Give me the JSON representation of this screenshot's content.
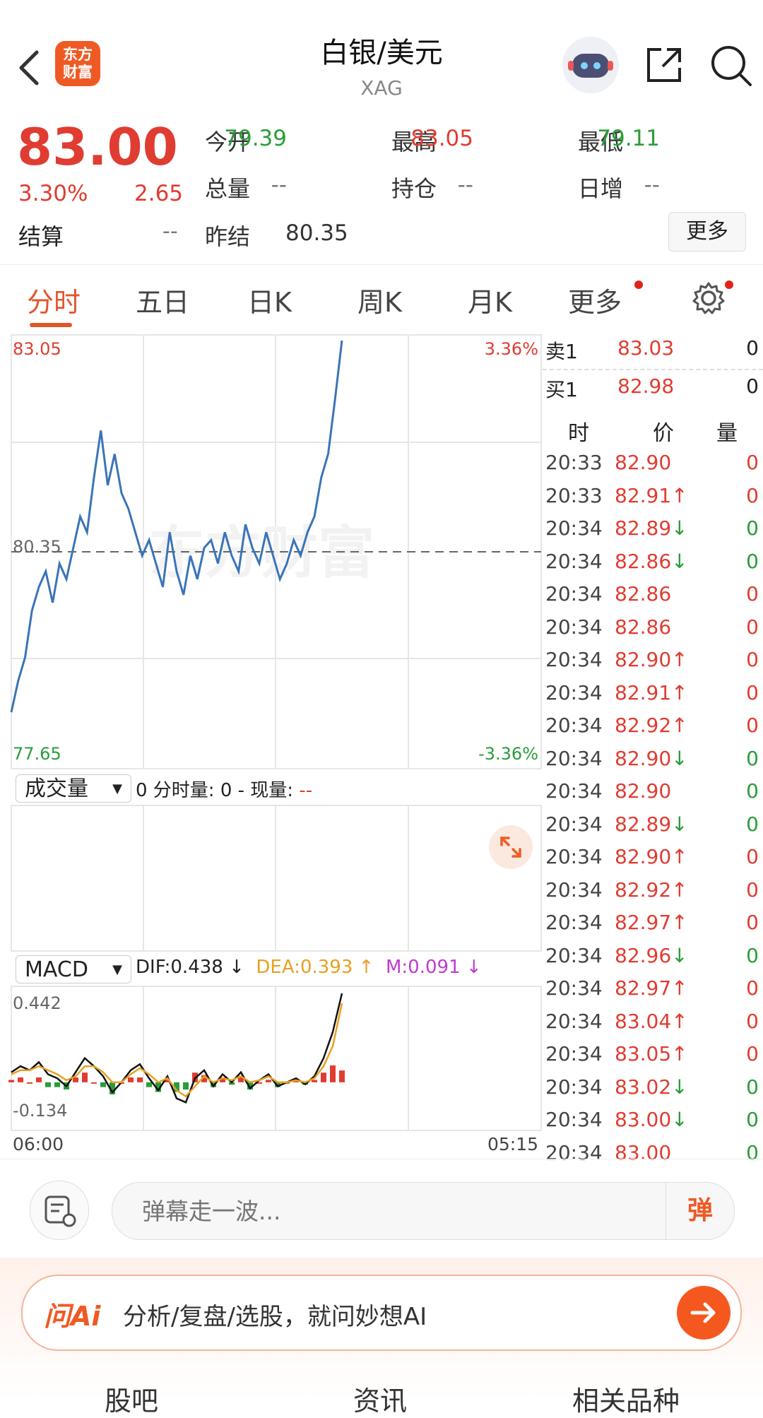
{
  "header": {
    "logo_line1": "东方",
    "logo_line2": "财富",
    "title": "白银/美元",
    "subtitle": "XAG"
  },
  "quote": {
    "price": "83.00",
    "change_pct": "3.30%",
    "change_abs": "2.65",
    "settle_label": "结算",
    "settle_value": "--",
    "rows": [
      [
        {
          "label": "今开",
          "value": "79.39",
          "color": "green"
        },
        {
          "label": "最高",
          "value": "83.05",
          "color": "red"
        },
        {
          "label": "最低",
          "value": "79.11",
          "color": "green"
        }
      ],
      [
        {
          "label": "总量",
          "value": "--",
          "color": "gray"
        },
        {
          "label": "持仓",
          "value": "--",
          "color": "gray"
        },
        {
          "label": "日增",
          "value": "--",
          "color": "gray"
        }
      ],
      [
        {
          "label": "昨结",
          "value": "80.35",
          "color": "dark"
        }
      ]
    ],
    "more_button": "更多"
  },
  "tabs": [
    "分时",
    "五日",
    "日K",
    "周K",
    "月K",
    "更多"
  ],
  "chart_data": [
    {
      "type": "line",
      "title": "",
      "series": [
        {
          "values": [
            78.3,
            78.7,
            79.0,
            79.6,
            79.9,
            80.1,
            79.7,
            80.2,
            80.0,
            80.4,
            80.8,
            80.6,
            81.3,
            81.9,
            81.2,
            81.6,
            81.1,
            80.9,
            80.6,
            80.3,
            80.5,
            80.2,
            79.9,
            80.6,
            80.1,
            79.8,
            80.3,
            80.0,
            80.4,
            80.5,
            80.2,
            80.6,
            80.3,
            80.1,
            80.7,
            80.4,
            80.2,
            80.6,
            80.3,
            80.0,
            80.2,
            80.5,
            80.3,
            80.6,
            80.8,
            81.3,
            81.6,
            82.3,
            83.05
          ]
        }
      ],
      "ylim": [
        77.65,
        83.05
      ],
      "ref_line": 80.35,
      "y_ticks": [
        "83.05",
        "80.35",
        "77.65"
      ],
      "pct_ticks": [
        "3.36%",
        "-3.36%"
      ],
      "x_ticks": [
        "06:00",
        "05:15"
      ]
    },
    {
      "type": "line",
      "title": "",
      "series": [
        {
          "name": "DIF",
          "values": [
            0.05,
            0.08,
            0.06,
            0.1,
            0.04,
            0.02,
            -0.02,
            0.05,
            0.12,
            0.08,
            0.03,
            -0.05,
            0.0,
            0.06,
            0.09,
            0.02,
            -0.04,
            0.03,
            -0.08,
            -0.1,
            0.02,
            0.06,
            -0.02,
            0.04,
            0.0,
            0.05,
            -0.03,
            0.01,
            0.04,
            -0.02,
            0.0,
            0.02,
            -0.01,
            0.03,
            0.12,
            0.25,
            0.442
          ]
        },
        {
          "name": "DEA",
          "values": [
            0.04,
            0.06,
            0.06,
            0.08,
            0.06,
            0.04,
            0.01,
            0.03,
            0.08,
            0.08,
            0.05,
            0.0,
            0.0,
            0.04,
            0.07,
            0.04,
            0.0,
            0.02,
            -0.04,
            -0.07,
            -0.02,
            0.03,
            0.0,
            0.02,
            0.01,
            0.03,
            0.0,
            0.01,
            0.03,
            0.0,
            0.0,
            0.01,
            0.0,
            0.02,
            0.08,
            0.18,
            0.393
          ]
        }
      ],
      "ylim": [
        -0.134,
        0.442
      ],
      "y_ticks": [
        "0.442",
        "-0.134"
      ]
    }
  ],
  "volume": {
    "selector": "成交量",
    "info": "0 分时量: 0 - 现量: ",
    "info_tail": "--"
  },
  "macd": {
    "selector": "MACD",
    "dif": "DIF:0.438 ↓",
    "dea": "DEA:0.393 ↑",
    "m": "M:0.091 ↓"
  },
  "book": {
    "sell_label": "卖1",
    "sell_price": "83.03",
    "sell_vol": "0",
    "buy_label": "买1",
    "buy_price": "82.98",
    "buy_vol": "0",
    "head": [
      "时",
      "价",
      "量"
    ]
  },
  "ticks": [
    [
      "20:33",
      "82.90",
      "",
      "0"
    ],
    [
      "20:33",
      "82.91",
      "↑",
      "0"
    ],
    [
      "20:34",
      "82.89",
      "↓",
      "0"
    ],
    [
      "20:34",
      "82.86",
      "↓",
      "0"
    ],
    [
      "20:34",
      "82.86",
      "",
      "0"
    ],
    [
      "20:34",
      "82.86",
      "",
      "0"
    ],
    [
      "20:34",
      "82.90",
      "↑",
      "0"
    ],
    [
      "20:34",
      "82.91",
      "↑",
      "0"
    ],
    [
      "20:34",
      "82.92",
      "↑",
      "0"
    ],
    [
      "20:34",
      "82.90",
      "↓",
      "0"
    ],
    [
      "20:34",
      "82.90",
      "",
      "0"
    ],
    [
      "20:34",
      "82.89",
      "↓",
      "0"
    ],
    [
      "20:34",
      "82.90",
      "↑",
      "0"
    ],
    [
      "20:34",
      "82.92",
      "↑",
      "0"
    ],
    [
      "20:34",
      "82.97",
      "↑",
      "0"
    ],
    [
      "20:34",
      "82.96",
      "↓",
      "0"
    ],
    [
      "20:34",
      "82.97",
      "↑",
      "0"
    ],
    [
      "20:34",
      "83.04",
      "↑",
      "0"
    ],
    [
      "20:34",
      "83.05",
      "↑",
      "0"
    ],
    [
      "20:34",
      "83.02",
      "↓",
      "0"
    ],
    [
      "20:34",
      "83.00",
      "↓",
      "0"
    ],
    [
      "20:34",
      "83.00",
      "",
      "0"
    ]
  ],
  "input": {
    "placeholder": "弹幕走一波...",
    "send": "弹"
  },
  "ai": {
    "logo": "问Ai",
    "text": "分析/复盘/选股，就问妙想AI"
  },
  "bottom_tabs": [
    "股吧",
    "资讯",
    "相关品种"
  ],
  "colors": {
    "up": "#e03c31",
    "down": "#2a9d3a",
    "accent": "#ef5a24",
    "line": "#3a74b8",
    "dea": "#e8a020",
    "m": "#c03ccf"
  }
}
